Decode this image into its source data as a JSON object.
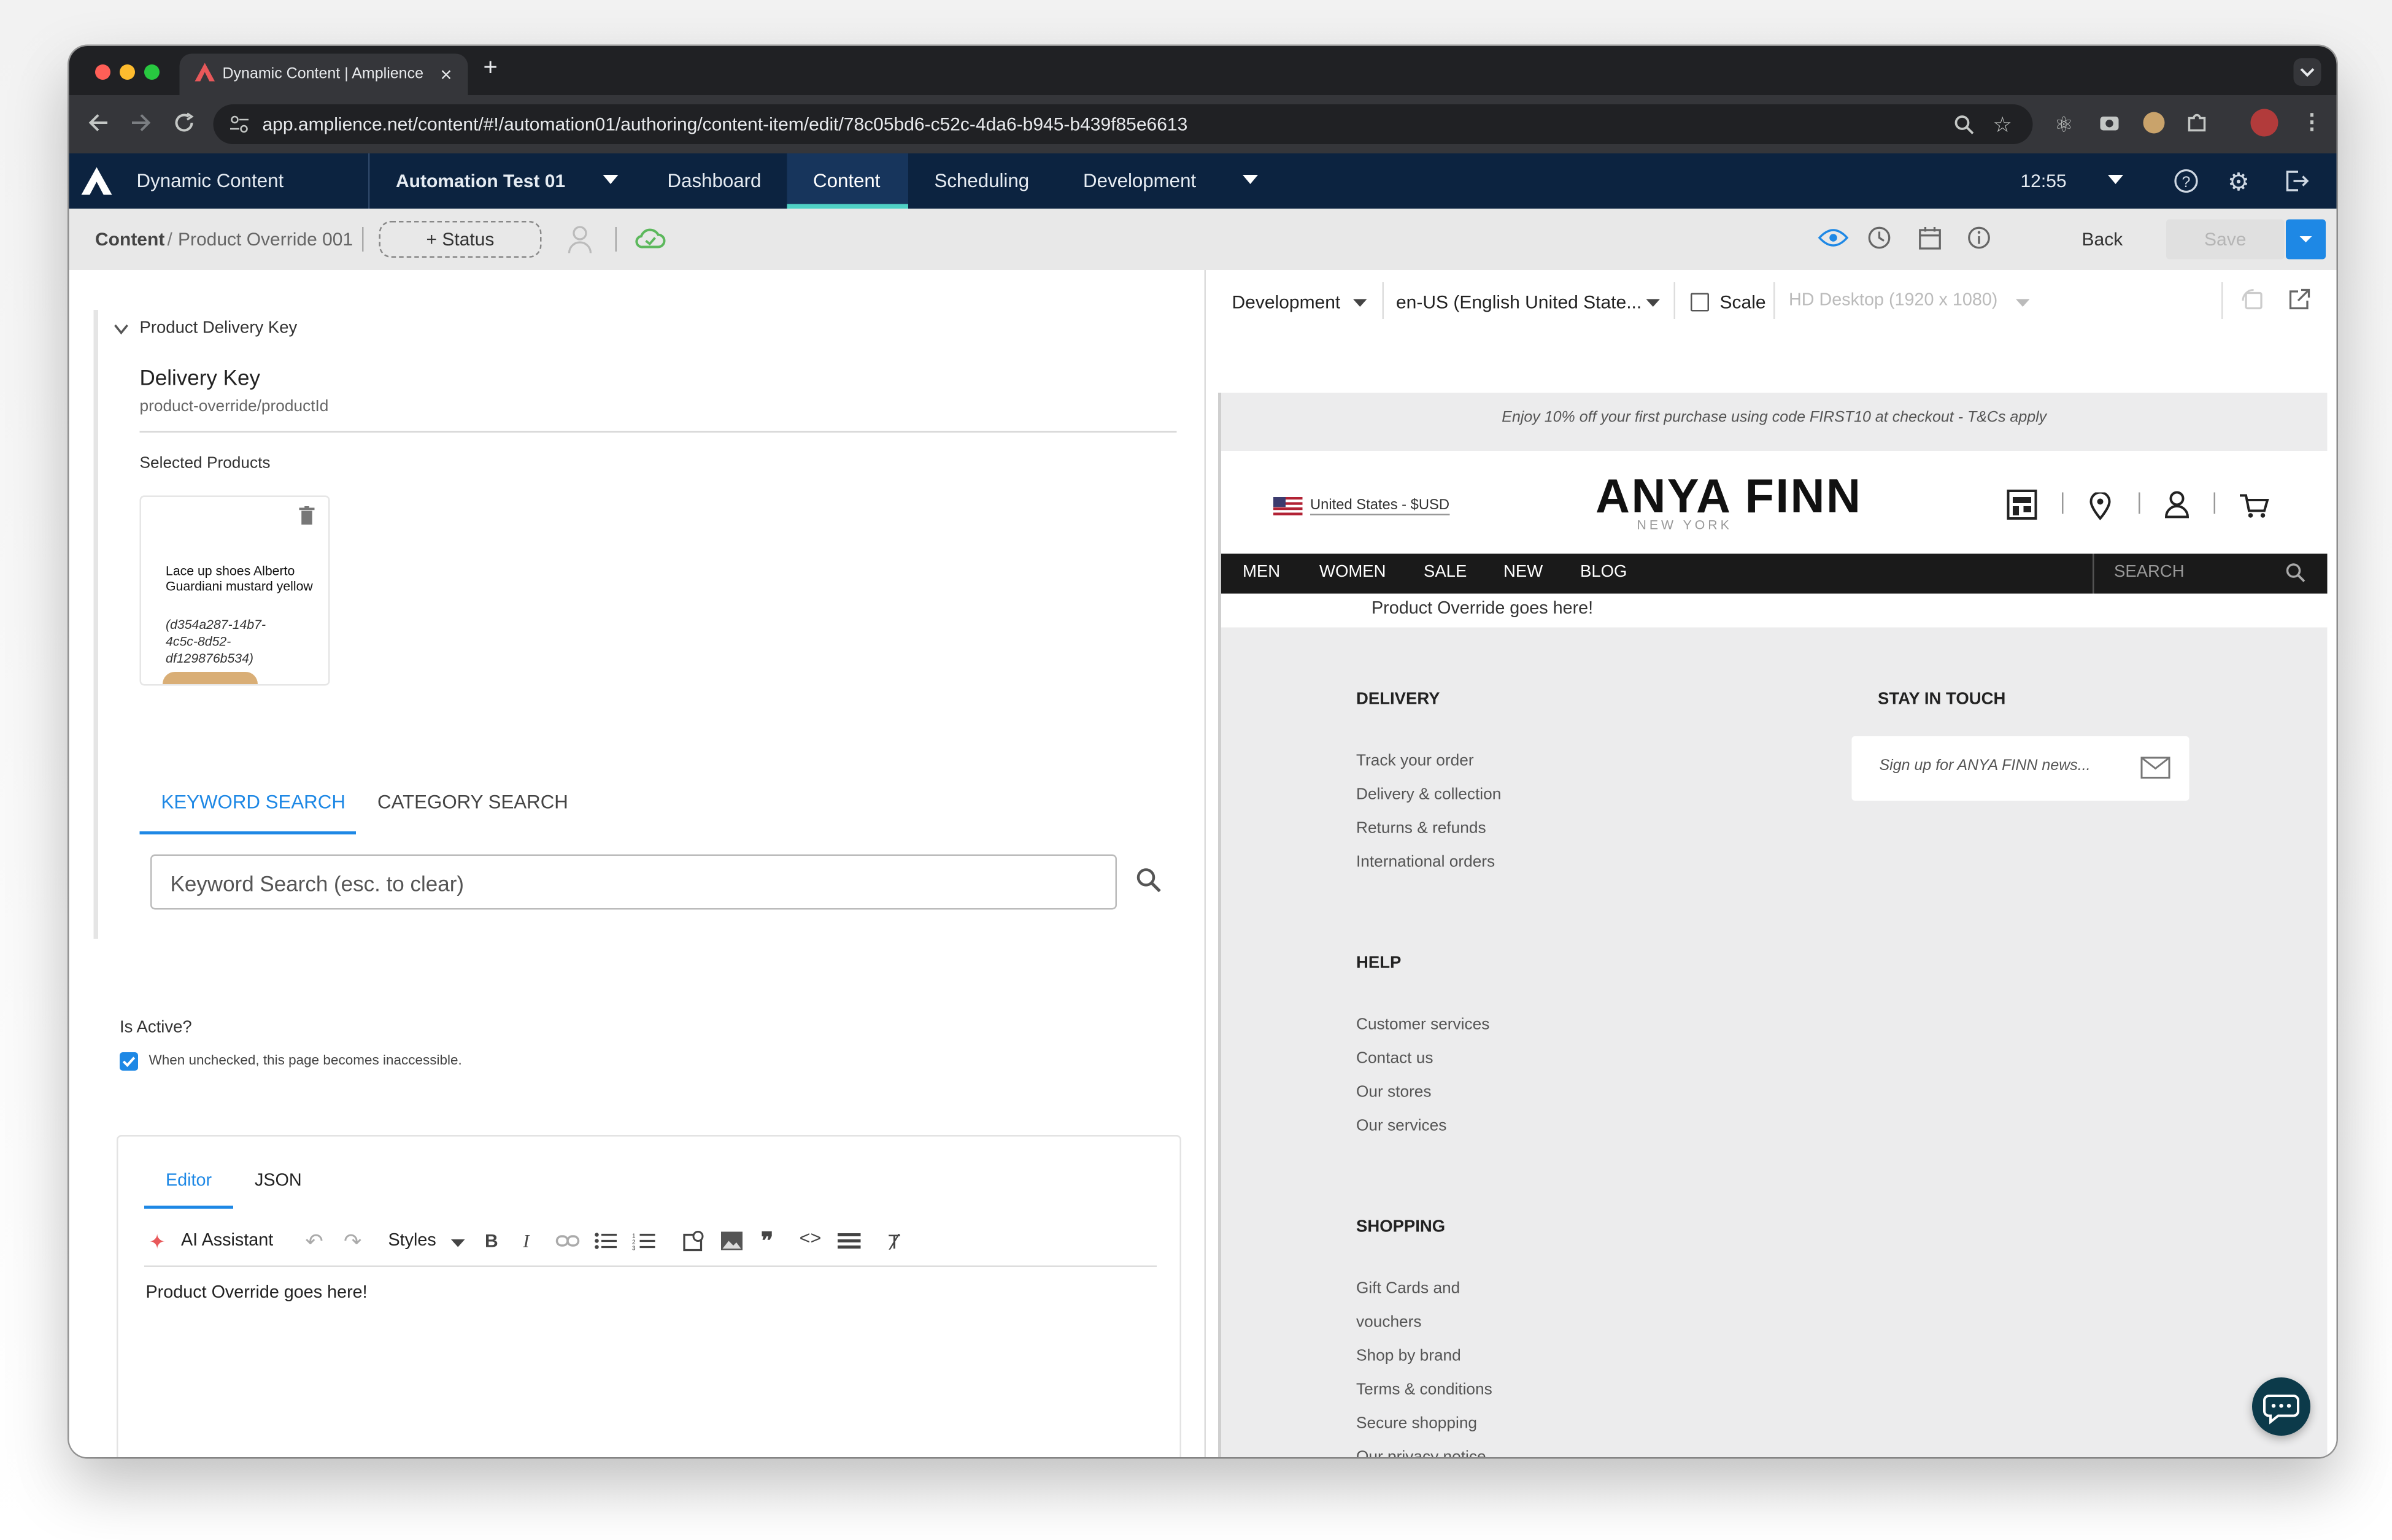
{
  "browser": {
    "tab_title": "Dynamic Content | Amplience",
    "tab_close": "×",
    "new_tab": "+",
    "url": "app.amplience.net/content/#!/automation01/authoring/content-item/edit/78c05bd6-c52c-4da6-b945-b439f85e6613"
  },
  "appnav": {
    "product": "Dynamic Content",
    "hub": "Automation Test 01",
    "tabs": [
      {
        "label": "Dashboard"
      },
      {
        "label": "Content"
      },
      {
        "label": "Scheduling"
      },
      {
        "label": "Development"
      }
    ],
    "time": "12:55"
  },
  "subbar": {
    "crumb_root": "Content",
    "crumb_sep": "/",
    "crumb_item": "Product Override 001",
    "status_button": "+ Status",
    "back": "Back",
    "save": "Save"
  },
  "editor": {
    "section_title": "Product Delivery Key",
    "delivery_key_label": "Delivery Key",
    "delivery_key_value": "product-override/productId",
    "selected_products_label": "Selected Products",
    "product": {
      "name": "Lace up shoes Alberto Guardiani mustard yellow",
      "id": "(d354a287-14b7-4c5c-8d52-df129876b534)"
    },
    "search_tabs": [
      "KEYWORD SEARCH",
      "CATEGORY SEARCH"
    ],
    "search_placeholder": "Keyword Search (esc. to clear)",
    "is_active_label": "Is Active?",
    "is_active_help": "When unchecked, this page becomes inaccessible.",
    "rich_tabs": [
      "Editor",
      "JSON"
    ],
    "ai_assistant": "AI Assistant",
    "styles": "Styles",
    "body_text": "Product Override goes here!"
  },
  "preview": {
    "environment": "Development",
    "locale": "en-US (English United State...",
    "scale_label": "Scale",
    "device": "HD Desktop (1920 x 1080)",
    "promo": "Enjoy 10% off your first purchase using code FIRST10 at checkout - T&Cs apply",
    "region": "United States - $USD",
    "brand_line1": "ANYA FINN",
    "brand_line2": "NEW YORK",
    "menu": [
      "MEN",
      "WOMEN",
      "SALE",
      "NEW",
      "BLOG"
    ],
    "search": "SEARCH",
    "override_text": "Product Override goes here!",
    "footer": {
      "delivery_title": "DELIVERY",
      "delivery_links": [
        "Track your order",
        "Delivery & collection",
        "Returns & refunds",
        "International orders"
      ],
      "help_title": "HELP",
      "help_links": [
        "Customer services",
        "Contact us",
        "Our stores",
        "Our services"
      ],
      "shopping_title": "SHOPPING",
      "shopping_links": [
        "Gift Cards and",
        "vouchers",
        "Shop by brand",
        "Terms & conditions",
        "Secure shopping",
        "Our privacy notice"
      ],
      "stay_title": "STAY IN TOUCH",
      "signup_placeholder": "Sign up for ANYA FINN news..."
    }
  },
  "colors": {
    "nav_bg": "#0c2340",
    "accent": "#1e88e5",
    "active_tab_underline": "#4fd1c5",
    "save_bg": "#e0e0e0",
    "cloud_green": "#5cb85c"
  }
}
